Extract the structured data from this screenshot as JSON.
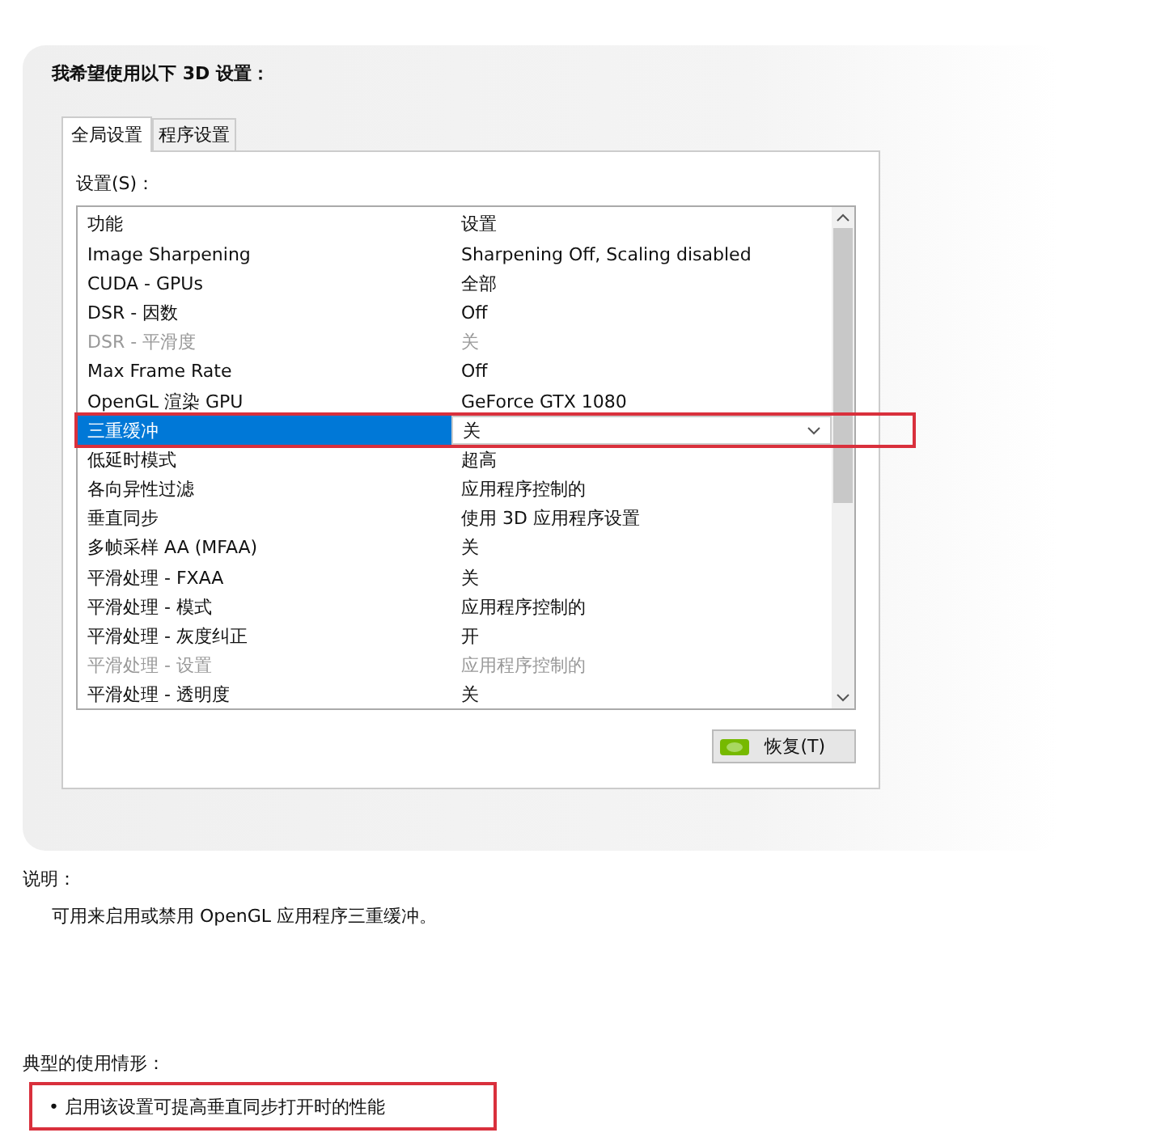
{
  "panel": {
    "heading": "我希望使用以下 3D 设置：",
    "tabs": [
      {
        "label": "全局设置",
        "selected": true
      },
      {
        "label": "程序设置",
        "selected": false
      }
    ],
    "settings_label": "设置(S)：",
    "table": {
      "columns": [
        "功能",
        "设置"
      ],
      "rows": [
        {
          "feature": "Image Sharpening",
          "value": "Sharpening Off, Scaling disabled",
          "disabled": false,
          "selected": false,
          "highlighted": false
        },
        {
          "feature": "CUDA - GPUs",
          "value": "全部",
          "disabled": false,
          "selected": false,
          "highlighted": false
        },
        {
          "feature": "DSR - 因数",
          "value": "Off",
          "disabled": false,
          "selected": false,
          "highlighted": false
        },
        {
          "feature": "DSR - 平滑度",
          "value": "关",
          "disabled": true,
          "selected": false,
          "highlighted": false
        },
        {
          "feature": "Max Frame Rate",
          "value": "Off",
          "disabled": false,
          "selected": false,
          "highlighted": false
        },
        {
          "feature": "OpenGL 渲染 GPU",
          "value": "GeForce GTX 1080",
          "disabled": false,
          "selected": false,
          "highlighted": false
        },
        {
          "feature": "三重缓冲",
          "value": "关",
          "disabled": false,
          "selected": true,
          "highlighted": true
        },
        {
          "feature": "低延时模式",
          "value": "超高",
          "disabled": false,
          "selected": false,
          "highlighted": false
        },
        {
          "feature": "各向异性过滤",
          "value": "应用程序控制的",
          "disabled": false,
          "selected": false,
          "highlighted": false
        },
        {
          "feature": "垂直同步",
          "value": "使用 3D 应用程序设置",
          "disabled": false,
          "selected": false,
          "highlighted": false
        },
        {
          "feature": "多帧采样 AA (MFAA)",
          "value": "关",
          "disabled": false,
          "selected": false,
          "highlighted": false
        },
        {
          "feature": "平滑处理 - FXAA",
          "value": "关",
          "disabled": false,
          "selected": false,
          "highlighted": false
        },
        {
          "feature": "平滑处理 - 模式",
          "value": "应用程序控制的",
          "disabled": false,
          "selected": false,
          "highlighted": false
        },
        {
          "feature": "平滑处理 - 灰度纠正",
          "value": "开",
          "disabled": false,
          "selected": false,
          "highlighted": false
        },
        {
          "feature": "平滑处理 - 设置",
          "value": "应用程序控制的",
          "disabled": true,
          "selected": false,
          "highlighted": false
        },
        {
          "feature": "平滑处理 - 透明度",
          "value": "关",
          "disabled": false,
          "selected": false,
          "highlighted": false
        }
      ]
    },
    "restore_button": "恢复(T)"
  },
  "description": {
    "title": "说明：",
    "text": "可用来启用或禁用 OpenGL 应用程序三重缓冲。"
  },
  "usage": {
    "title": "典型的使用情形：",
    "items": [
      {
        "bullet": "•",
        "text": "启用该设置可提高垂直同步打开时的性能",
        "highlighted": true
      }
    ]
  }
}
